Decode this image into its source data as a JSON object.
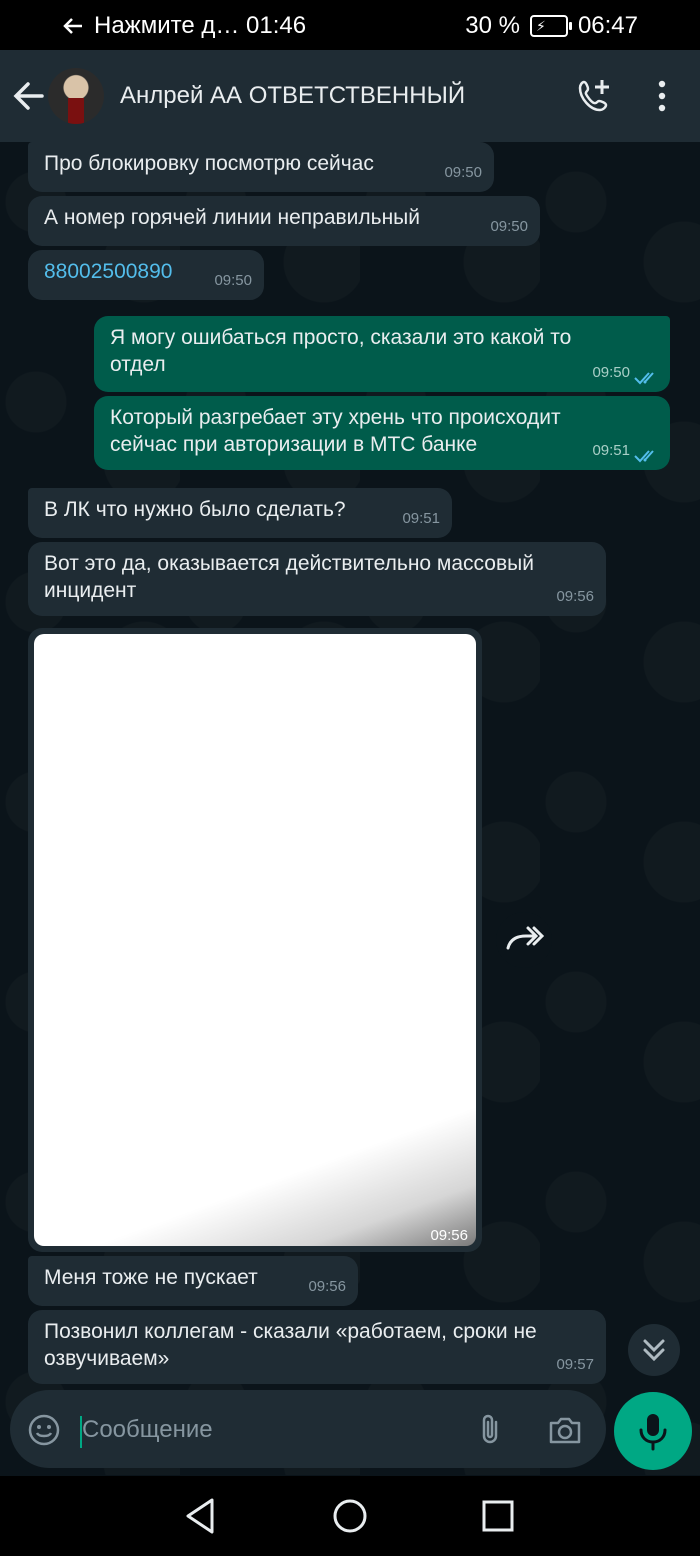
{
  "status_bar": {
    "notification": "Нажмите д… 01:46",
    "battery": "30 %",
    "time": "06:47"
  },
  "header": {
    "contact_name": "Анлрей АА ОТВЕТСТВЕННЫЙ"
  },
  "messages": [
    {
      "dir": "in",
      "text": "Про блокировку посмотрю сейчас",
      "time": "09:50"
    },
    {
      "dir": "in",
      "text": "А номер горячей линии неправильный",
      "time": "09:50"
    },
    {
      "dir": "in",
      "text": "88002500890",
      "time": "09:50",
      "is_link": true
    },
    {
      "dir": "out",
      "text": "Я могу ошибаться просто, сказали это какой то отдел",
      "time": "09:50",
      "status": "read"
    },
    {
      "dir": "out",
      "text": "Который разгребает эту хрень что происходит сейчас при авторизации в МТС банке",
      "time": "09:51",
      "status": "read"
    },
    {
      "dir": "in",
      "text": "В ЛК что нужно было сделать?",
      "time": "09:51"
    },
    {
      "dir": "in",
      "text": "Вот это да, оказывается действительно массовый инцидент",
      "time": "09:56"
    },
    {
      "dir": "in",
      "type": "image",
      "time": "09:56"
    },
    {
      "dir": "in",
      "text": "Меня тоже не пускает",
      "time": "09:56"
    },
    {
      "dir": "in",
      "text": "Позвонил коллегам - сказали «работаем, сроки не озвучиваем»",
      "time": "09:57"
    }
  ],
  "composer": {
    "placeholder": "Сообщение"
  },
  "colors": {
    "background": "#0b141a",
    "incoming_bubble": "#1f2c34",
    "outgoing_bubble": "#005c4b",
    "accent": "#00a884",
    "link": "#53bdeb",
    "read_ticks": "#53bdeb"
  },
  "icons": {
    "back": "arrow-left-icon",
    "call": "add-call-icon",
    "more": "more-vertical-icon",
    "forward": "forward-icon",
    "scroll": "chevron-double-down-icon",
    "emoji": "emoji-icon",
    "attach": "paperclip-icon",
    "camera": "camera-icon",
    "mic": "microphone-icon"
  }
}
